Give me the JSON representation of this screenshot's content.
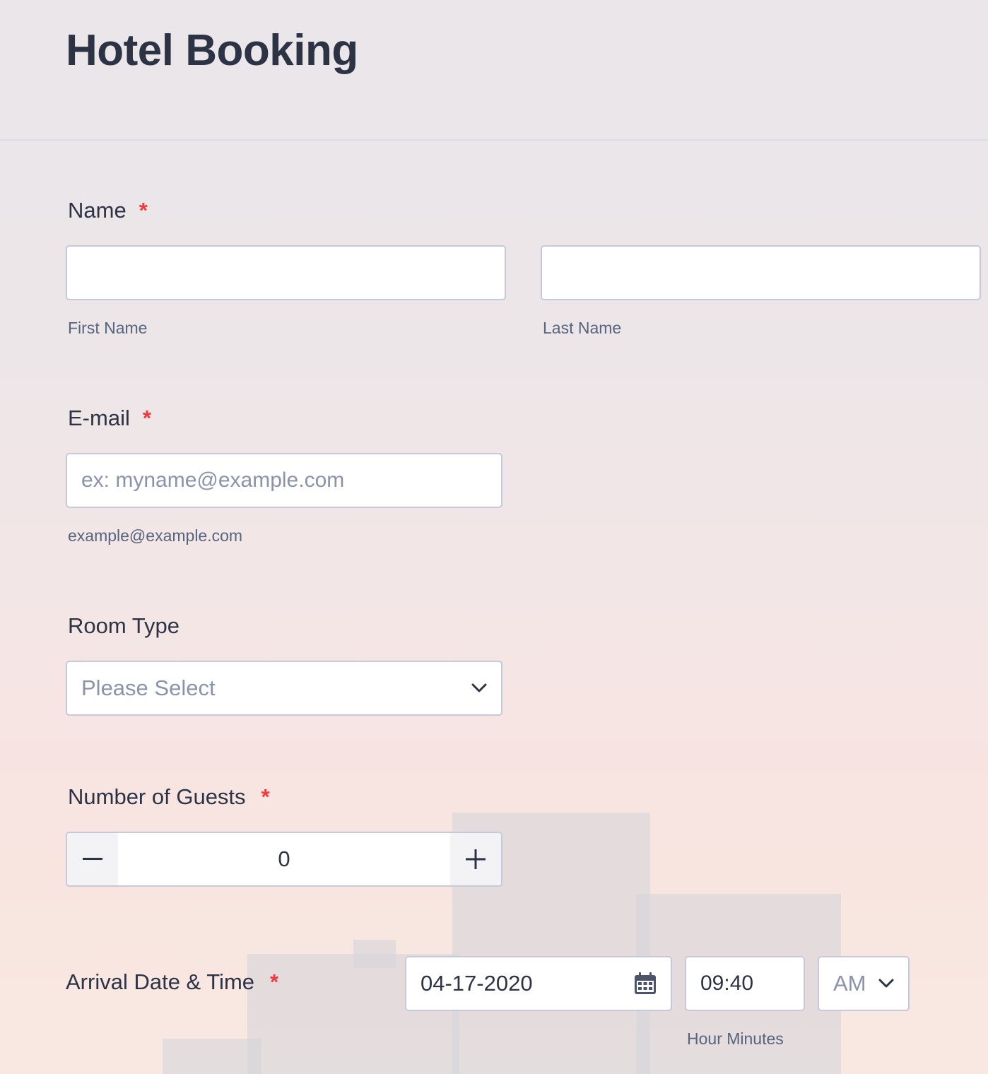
{
  "form": {
    "title": "Hotel Booking"
  },
  "name_field": {
    "label": "Name",
    "required_mark": "*",
    "first": {
      "value": "",
      "sublabel": "First Name"
    },
    "last": {
      "value": "",
      "sublabel": "Last Name"
    }
  },
  "email_field": {
    "label": "E-mail",
    "required_mark": "*",
    "value": "",
    "placeholder": "ex: myname@example.com",
    "sublabel": "example@example.com"
  },
  "room_type": {
    "label": "Room Type",
    "selected": "Please Select"
  },
  "guests": {
    "label": "Number of Guests",
    "required_mark": "*",
    "value": "0",
    "minus": "−",
    "plus": "+"
  },
  "arrival": {
    "label": "Arrival Date & Time",
    "required_mark": "*",
    "date": "04-17-2020",
    "time": "09:40",
    "ampm": "AM",
    "time_sublabel": "Hour Minutes"
  },
  "icons": {
    "calendar": "calendar-icon",
    "dropdown": "chevron-down-icon"
  },
  "colors": {
    "required": "#f23a3c",
    "text": "#2c3345",
    "border": "#c5c9da",
    "placeholder": "#8b93a8"
  }
}
